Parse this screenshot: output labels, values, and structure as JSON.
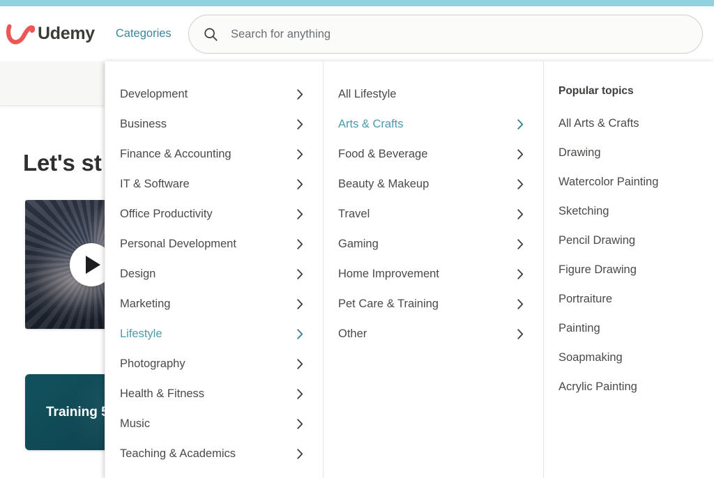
{
  "browser": {
    "accent_color": "#91d2e0"
  },
  "header": {
    "logo_text": "Udemy",
    "logo_icon": "udemy-u-logo",
    "logo_color": "#eb5757",
    "nav_categories_label": "Categories",
    "nav_link_color": "#39879b",
    "search": {
      "icon": "search-icon",
      "placeholder": "Search for anything",
      "value": ""
    }
  },
  "background_page": {
    "hero_title": "Let's st",
    "video_card": {
      "play_icon": "play-icon"
    },
    "promo_card": {
      "text": "Training 5",
      "background_color": "#114f5b"
    }
  },
  "mega_menu": {
    "active_color": "#4d9aab",
    "primary_categories": [
      {
        "label": "Development",
        "has_chevron": true,
        "active": false
      },
      {
        "label": "Business",
        "has_chevron": true,
        "active": false
      },
      {
        "label": "Finance & Accounting",
        "has_chevron": true,
        "active": false
      },
      {
        "label": "IT & Software",
        "has_chevron": true,
        "active": false
      },
      {
        "label": "Office Productivity",
        "has_chevron": true,
        "active": false
      },
      {
        "label": "Personal Development",
        "has_chevron": true,
        "active": false
      },
      {
        "label": "Design",
        "has_chevron": true,
        "active": false
      },
      {
        "label": "Marketing",
        "has_chevron": true,
        "active": false
      },
      {
        "label": "Lifestyle",
        "has_chevron": true,
        "active": true
      },
      {
        "label": "Photography",
        "has_chevron": true,
        "active": false
      },
      {
        "label": "Health & Fitness",
        "has_chevron": true,
        "active": false
      },
      {
        "label": "Music",
        "has_chevron": true,
        "active": false
      },
      {
        "label": "Teaching & Academics",
        "has_chevron": true,
        "active": false
      }
    ],
    "secondary_categories": [
      {
        "label": "All Lifestyle",
        "has_chevron": false,
        "active": false
      },
      {
        "label": "Arts & Crafts",
        "has_chevron": true,
        "active": true
      },
      {
        "label": "Food & Beverage",
        "has_chevron": true,
        "active": false
      },
      {
        "label": "Beauty & Makeup",
        "has_chevron": true,
        "active": false
      },
      {
        "label": "Travel",
        "has_chevron": true,
        "active": false
      },
      {
        "label": "Gaming",
        "has_chevron": true,
        "active": false
      },
      {
        "label": "Home Improvement",
        "has_chevron": true,
        "active": false
      },
      {
        "label": "Pet Care & Training",
        "has_chevron": true,
        "active": false
      },
      {
        "label": "Other",
        "has_chevron": true,
        "active": false
      }
    ],
    "topics_heading": "Popular topics",
    "topics": [
      {
        "label": "All Arts & Crafts"
      },
      {
        "label": "Drawing"
      },
      {
        "label": "Watercolor Painting"
      },
      {
        "label": "Sketching"
      },
      {
        "label": "Pencil Drawing"
      },
      {
        "label": "Figure Drawing"
      },
      {
        "label": "Portraiture"
      },
      {
        "label": "Painting"
      },
      {
        "label": "Soapmaking"
      },
      {
        "label": "Acrylic Painting"
      }
    ]
  }
}
